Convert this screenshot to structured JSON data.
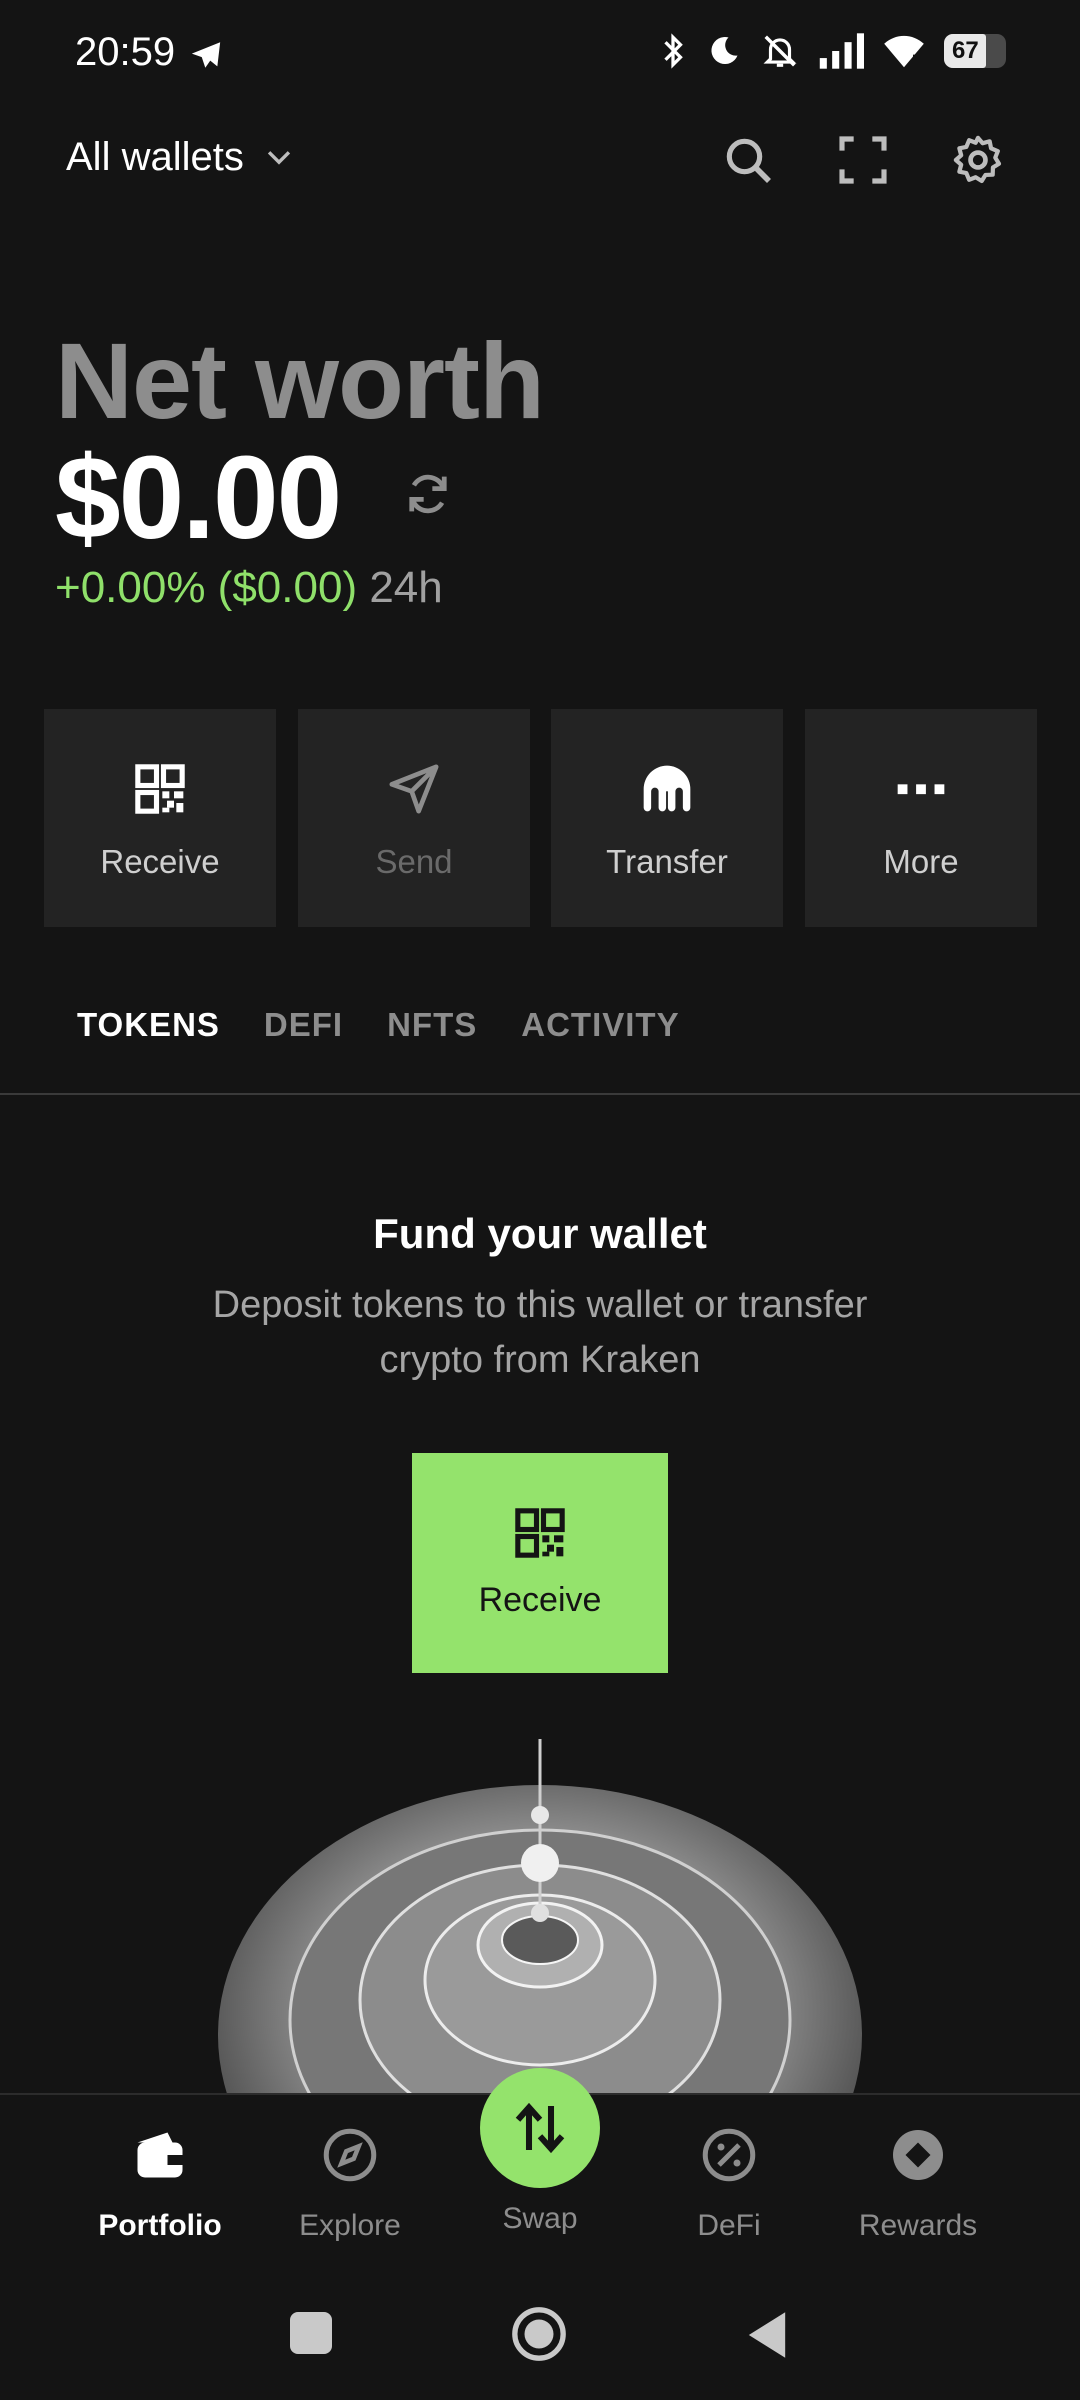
{
  "status_bar": {
    "time": "20:59",
    "battery": "67",
    "battery_level": 0.67,
    "icons": [
      "telegram-icon",
      "bluetooth-icon",
      "moon-icon",
      "bell-off-icon",
      "signal-icon",
      "wifi-icon",
      "battery-icon"
    ]
  },
  "header": {
    "wallet_label": "All wallets",
    "icons": [
      "search-icon",
      "scan-icon",
      "settings-icon"
    ]
  },
  "portfolio": {
    "net_worth_label": "Net worth",
    "net_worth_value": "$0.00",
    "change": "+0.00% ($0.00)",
    "period": "24h"
  },
  "actions": [
    {
      "label": "Receive",
      "icon": "qr-code-icon",
      "enabled": true
    },
    {
      "label": "Send",
      "icon": "send-icon",
      "enabled": false
    },
    {
      "label": "Transfer",
      "icon": "kraken-icon",
      "enabled": true
    },
    {
      "label": "More",
      "icon": "more-icon",
      "enabled": true
    }
  ],
  "tabs": [
    {
      "label": "TOKENS",
      "active": true
    },
    {
      "label": "DEFI",
      "active": false
    },
    {
      "label": "NFTS",
      "active": false
    },
    {
      "label": "ACTIVITY",
      "active": false
    }
  ],
  "empty_state": {
    "title": "Fund your wallet",
    "description": "Deposit tokens to this wallet or transfer crypto from Kraken",
    "button_label": "Receive"
  },
  "bottom_nav": [
    {
      "label": "Portfolio",
      "icon": "wallet-icon",
      "active": true
    },
    {
      "label": "Explore",
      "icon": "compass-icon",
      "active": false
    },
    {
      "label": "Swap",
      "icon": "swap-icon",
      "active": false
    },
    {
      "label": "DeFi",
      "icon": "percent-icon",
      "active": false
    },
    {
      "label": "Rewards",
      "icon": "rewards-icon",
      "active": false
    }
  ],
  "system_nav": [
    "recents-button",
    "home-button",
    "back-button"
  ],
  "colors": {
    "background": "#141414",
    "tile": "#232323",
    "accent": "#94e36c",
    "positive": "#8fe06a",
    "muted": "#8d8d8d"
  }
}
